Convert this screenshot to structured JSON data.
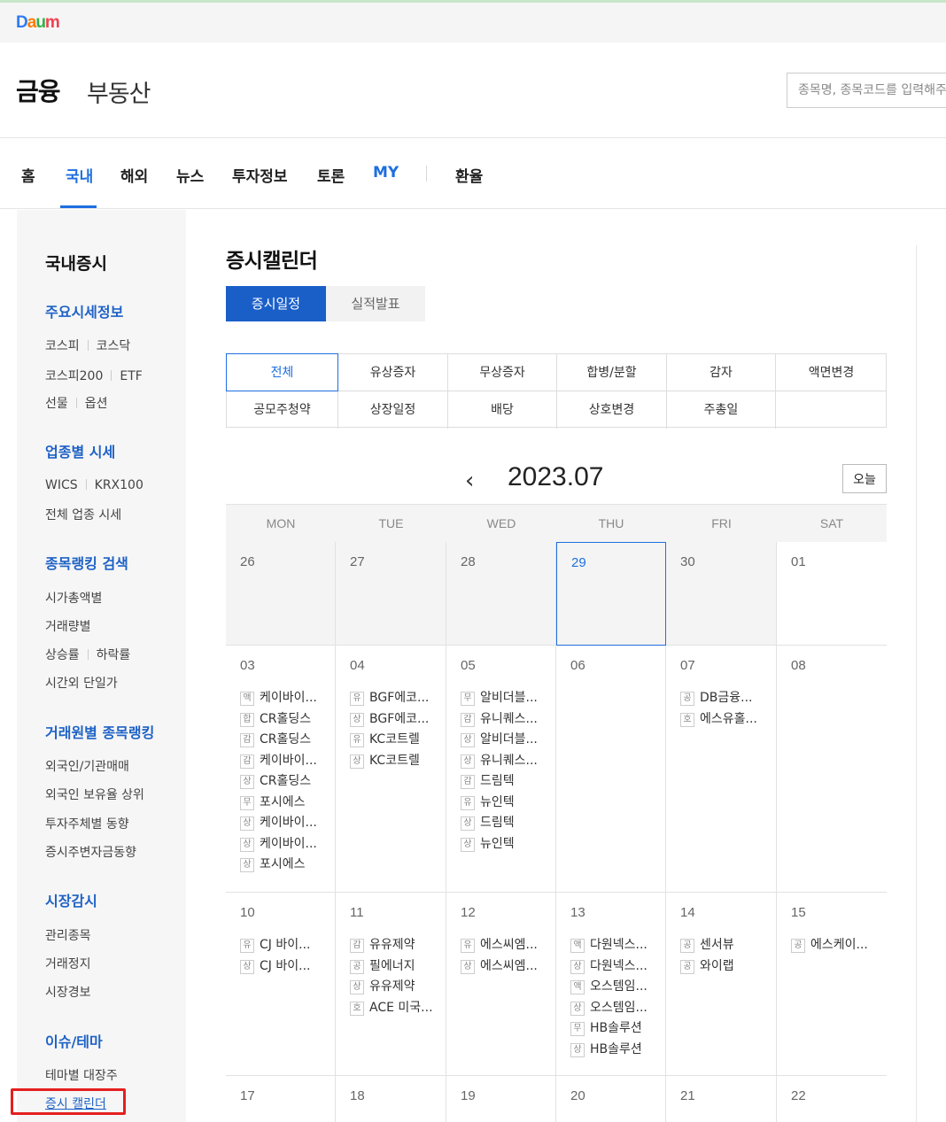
{
  "topbar": {
    "logo_letters": [
      "D",
      "a",
      "u",
      "m"
    ]
  },
  "header": {
    "brand": "금융",
    "realestate": "부동산",
    "search_placeholder": "종목명, 종목코드를 입력해주세요"
  },
  "gnb": {
    "items": [
      "홈",
      "국내",
      "해외",
      "뉴스",
      "투자정보",
      "토론",
      "MY",
      "환율"
    ],
    "active": "국내"
  },
  "lnb": {
    "title": "국내증시",
    "sections": [
      {
        "head": "주요시세정보",
        "rows": [
          [
            "코스피",
            "코스닥"
          ],
          [
            "코스피200",
            "ETF"
          ],
          [
            "선물",
            "옵션"
          ]
        ]
      },
      {
        "head": "업종별 시세",
        "rows": [
          [
            "WICS",
            "KRX100"
          ],
          [
            "전체 업종 시세"
          ]
        ]
      },
      {
        "head": "종목랭킹 검색",
        "rows": [
          [
            "시가총액별"
          ],
          [
            "거래량별"
          ],
          [
            "상승률",
            "하락률"
          ],
          [
            "시간외 단일가"
          ]
        ]
      },
      {
        "head": "거래원별 종목랭킹",
        "rows": [
          [
            "외국인/기관매매"
          ],
          [
            "외국인 보유율 상위"
          ],
          [
            "투자주체별 동향"
          ],
          [
            "증시주변자금동향"
          ]
        ]
      },
      {
        "head": "시장감시",
        "rows": [
          [
            "관리종목"
          ],
          [
            "거래정지"
          ],
          [
            "시장경보"
          ]
        ]
      },
      {
        "head": "이슈/테마",
        "rows": [
          [
            "테마별 대장주"
          ],
          [
            "증시 캘린더"
          ]
        ]
      }
    ]
  },
  "page": {
    "title": "증시캘린더",
    "tabs": [
      "증시일정",
      "실적발표"
    ]
  },
  "filters": [
    [
      "전체",
      "유상증자",
      "무상증자",
      "합병/분할",
      "감자",
      "액면변경"
    ],
    [
      "공모주청약",
      "상장일정",
      "배당",
      "상호변경",
      "주총일",
      ""
    ]
  ],
  "calendar": {
    "month": "2023.07",
    "today_label": "오늘",
    "prev_icon": "‹",
    "weekdays": [
      "MON",
      "TUE",
      "WED",
      "THU",
      "FRI",
      "SAT"
    ],
    "selected_day": "29",
    "weeks": [
      [
        {
          "d": "26",
          "past": true,
          "ev": []
        },
        {
          "d": "27",
          "past": true,
          "ev": []
        },
        {
          "d": "28",
          "past": true,
          "ev": []
        },
        {
          "d": "29",
          "past": true,
          "ev": []
        },
        {
          "d": "30",
          "past": true,
          "ev": []
        },
        {
          "d": "01",
          "past": false,
          "ev": []
        }
      ],
      [
        {
          "d": "03",
          "ev": [
            [
              "액",
              "케이바이..."
            ],
            [
              "합",
              "CR홀딩스"
            ],
            [
              "감",
              "CR홀딩스"
            ],
            [
              "감",
              "케이바이..."
            ],
            [
              "상",
              "CR홀딩스"
            ],
            [
              "무",
              "포시에스"
            ],
            [
              "상",
              "케이바이..."
            ],
            [
              "상",
              "케이바이..."
            ],
            [
              "상",
              "포시에스"
            ]
          ]
        },
        {
          "d": "04",
          "ev": [
            [
              "유",
              "BGF에코..."
            ],
            [
              "상",
              "BGF에코..."
            ],
            [
              "유",
              "KC코트렐"
            ],
            [
              "상",
              "KC코트렐"
            ]
          ]
        },
        {
          "d": "05",
          "ev": [
            [
              "무",
              "알비더블..."
            ],
            [
              "감",
              "유니퀘스..."
            ],
            [
              "상",
              "알비더블..."
            ],
            [
              "상",
              "유니퀘스..."
            ],
            [
              "감",
              "드림텍"
            ],
            [
              "유",
              "뉴인텍"
            ],
            [
              "상",
              "드림텍"
            ],
            [
              "상",
              "뉴인텍"
            ]
          ]
        },
        {
          "d": "06",
          "ev": []
        },
        {
          "d": "07",
          "ev": [
            [
              "공",
              "DB금융..."
            ],
            [
              "호",
              "에스유홀..."
            ]
          ]
        },
        {
          "d": "08",
          "ev": []
        }
      ],
      [
        {
          "d": "10",
          "ev": [
            [
              "유",
              "CJ 바이..."
            ],
            [
              "상",
              "CJ 바이..."
            ]
          ]
        },
        {
          "d": "11",
          "ev": [
            [
              "감",
              "유유제약"
            ],
            [
              "공",
              "필에너지"
            ],
            [
              "상",
              "유유제약"
            ],
            [
              "호",
              "ACE 미국..."
            ]
          ]
        },
        {
          "d": "12",
          "ev": [
            [
              "유",
              "에스씨엠..."
            ],
            [
              "상",
              "에스씨엠..."
            ]
          ]
        },
        {
          "d": "13",
          "ev": [
            [
              "액",
              "다원넥스..."
            ],
            [
              "상",
              "다원넥스..."
            ],
            [
              "액",
              "오스템임..."
            ],
            [
              "상",
              "오스템임..."
            ],
            [
              "무",
              "HB솔루션"
            ],
            [
              "상",
              "HB솔루션"
            ]
          ]
        },
        {
          "d": "14",
          "ev": [
            [
              "공",
              "센서뷰"
            ],
            [
              "공",
              "와이랩"
            ]
          ]
        },
        {
          "d": "15",
          "ev": [
            [
              "공",
              "에스케이..."
            ]
          ]
        }
      ],
      [
        {
          "d": "17",
          "ev": []
        },
        {
          "d": "18",
          "ev": []
        },
        {
          "d": "19",
          "ev": []
        },
        {
          "d": "20",
          "ev": []
        },
        {
          "d": "21",
          "ev": []
        },
        {
          "d": "22",
          "ev": []
        }
      ]
    ]
  },
  "colors": {
    "accent": "#1e6fe0",
    "tab_active": "#1a5fc8",
    "lnb_bg": "#f6f6f6",
    "highlight_box": "#e51f1f"
  }
}
